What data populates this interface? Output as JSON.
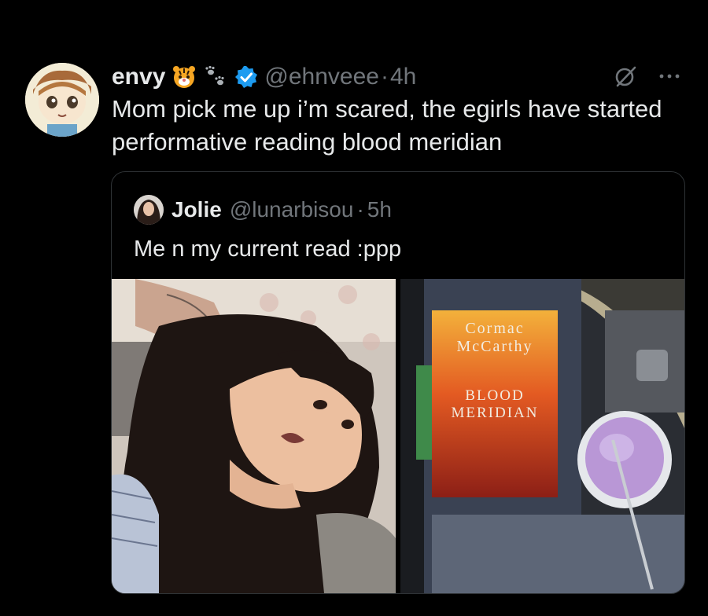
{
  "tweet": {
    "display_name": "envy",
    "handle": "@ehnveee",
    "separator": "·",
    "time": "4h",
    "text": "Mom pick me up i’m scared, the egirls have started performative reading blood meridian",
    "icons": [
      "tiger-face-emoji",
      "paw-prints-emoji",
      "verified-badge-icon",
      "grok-icon",
      "more-icon"
    ]
  },
  "quote": {
    "display_name": "Jolie",
    "handle": "@lunarbisou",
    "separator": "·",
    "time": "5h",
    "text": "Me n my current read :ppp",
    "book": {
      "author_line1": "Cormac",
      "author_line2": "McCarthy",
      "title_line1": "BLOOD",
      "title_line2": "MERIDIAN"
    }
  },
  "colors": {
    "background": "#000000",
    "text_primary": "#e7e9ea",
    "text_secondary": "#71767b",
    "border": "#2f3336",
    "verified": "#1d9bf0"
  }
}
